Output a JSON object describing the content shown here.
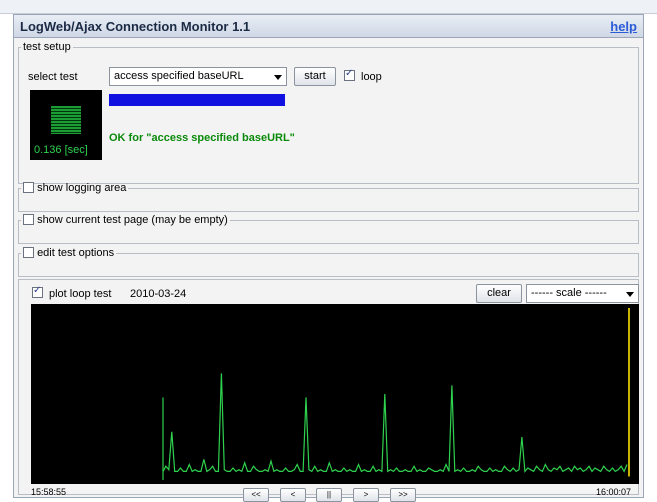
{
  "app": {
    "title": "LogWeb/Ajax Connection Monitor 1.1",
    "help_label": "help"
  },
  "test_setup": {
    "legend": "test setup",
    "select_label": "select test",
    "selected_test": "access specified baseURL",
    "start_label": "start",
    "loop_label": "loop",
    "loop_checked": true,
    "timer_text": "0.136 [sec]",
    "status_text": "OK for \"access specified baseURL\"",
    "progress_percent": 100
  },
  "sections": {
    "logging": {
      "label": "show logging area",
      "checked": false
    },
    "test_page": {
      "label": "show current test page (may be empty)",
      "checked": false
    },
    "test_options": {
      "label": "edit test options",
      "checked": false
    }
  },
  "plot": {
    "label": "plot loop test",
    "checked": true,
    "date": "2010-03-24",
    "clear_label": "clear",
    "scale_selected": "------ scale ------",
    "time_start": "15:58:55",
    "time_end": "16:00:07",
    "nav": [
      "<<",
      "<",
      "||",
      ">",
      ">>"
    ]
  },
  "colors": {
    "line": "#2fd24e",
    "marker": "#c8b400",
    "plot_bg": "#000000",
    "progress": "#1010e0"
  },
  "chart_data": {
    "type": "line",
    "baseline": 0.05,
    "series": [
      {
        "values": [
          0.05,
          0.08,
          0.06,
          0.28,
          0.05,
          0.05,
          0.07,
          0.05,
          0.05,
          0.09,
          0.05,
          0.06,
          0.05,
          0.05,
          0.12,
          0.05,
          0.06,
          0.08,
          0.05,
          0.05,
          0.62,
          0.06,
          0.05,
          0.05,
          0.07,
          0.05,
          0.06,
          0.05,
          0.1,
          0.05,
          0.05,
          0.08,
          0.06,
          0.05,
          0.05,
          0.06,
          0.05,
          0.11,
          0.05,
          0.06,
          0.05,
          0.05,
          0.07,
          0.05,
          0.05,
          0.06,
          0.09,
          0.05,
          0.05,
          0.48,
          0.06,
          0.05,
          0.08,
          0.05,
          0.06,
          0.05,
          0.05,
          0.1,
          0.05,
          0.06,
          0.05,
          0.05,
          0.07,
          0.05,
          0.06,
          0.05,
          0.05,
          0.09,
          0.05,
          0.06,
          0.05,
          0.05,
          0.08,
          0.05,
          0.06,
          0.05,
          0.5,
          0.05,
          0.06,
          0.05,
          0.07,
          0.05,
          0.05,
          0.06,
          0.05,
          0.05,
          0.08,
          0.05,
          0.06,
          0.05,
          0.05,
          0.07,
          0.06,
          0.05,
          0.05,
          0.06,
          0.05,
          0.09,
          0.05,
          0.55,
          0.05,
          0.06,
          0.05,
          0.07,
          0.05,
          0.05,
          0.06,
          0.05,
          0.08,
          0.06,
          0.05,
          0.05,
          0.07,
          0.05,
          0.06,
          0.05,
          0.05,
          0.08,
          0.06,
          0.05,
          0.07,
          0.05,
          0.06,
          0.25,
          0.05,
          0.07,
          0.06,
          0.05,
          0.08,
          0.06,
          0.05,
          0.09,
          0.06,
          0.05,
          0.07,
          0.06,
          0.08,
          0.05,
          0.06,
          0.07,
          0.05,
          0.08,
          0.06,
          0.07,
          0.05,
          0.06,
          0.08,
          0.05,
          0.07,
          0.06,
          0.05,
          0.08,
          0.06,
          0.05,
          0.07,
          0.05,
          0.06,
          0.08,
          0.05,
          0.09
        ],
        "spike_end": 1.0
      }
    ]
  }
}
